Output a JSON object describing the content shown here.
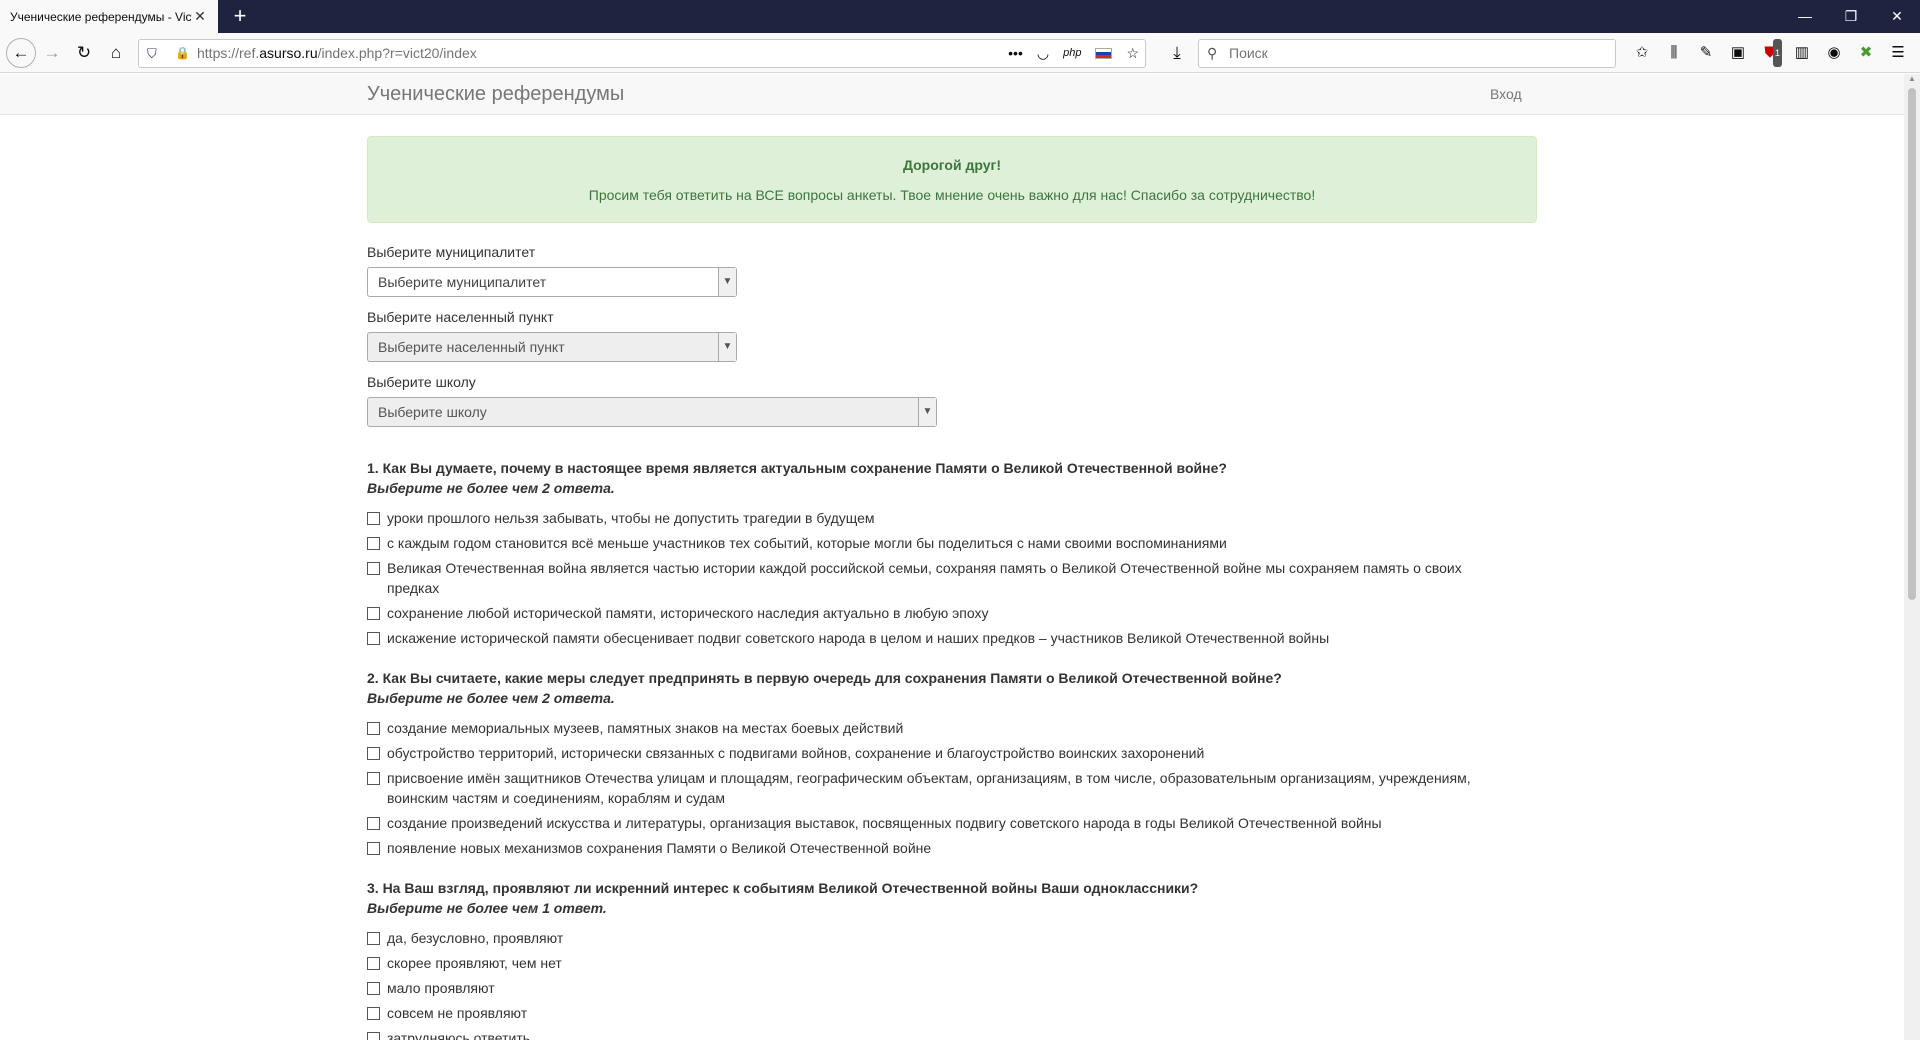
{
  "browser": {
    "tab_title": "Ученические референдумы - Vict",
    "tab_close": "✕",
    "new_tab": "+",
    "url_prefix": "https://ref.",
    "url_domain": "asurso.ru",
    "url_path": "/index.php?r=vict20/index",
    "search_placeholder": "Поиск",
    "php_label": "php",
    "icons": [
      "back-icon",
      "forward-icon",
      "reload-icon",
      "home-icon",
      "shield-icon",
      "lock-icon",
      "more-icon",
      "pocket-icon",
      "star-icon",
      "download-icon",
      "search-icon",
      "bookmarks-icon",
      "library-icon",
      "eyedropper-icon",
      "screenshot-icon",
      "ublock-icon",
      "sidebar-icon",
      "account-icon",
      "extension-icon",
      "menu-icon"
    ],
    "ublock_badge": "1"
  },
  "site": {
    "title": "Ученические референдумы",
    "login": "Вход"
  },
  "alert": {
    "title": "Дорогой друг!",
    "text": "Просим тебя ответить на ВСЕ вопросы анкеты. Твое мнение очень важно для нас! Спасибо за сотрудничество!"
  },
  "filters": {
    "municipality": {
      "label": "Выберите муниципалитет",
      "value": "Выберите муниципалитет"
    },
    "locality": {
      "label": "Выберите населенный пункт",
      "value": "Выберите населенный пункт"
    },
    "school": {
      "label": "Выберите школу",
      "value": "Выберите школу"
    }
  },
  "questions": [
    {
      "title": "1. Как Вы думаете, почему в настоящее время является актуальным сохранение Памяти о Великой Отечественной войне?",
      "hint": "Выберите не более чем 2 ответа.",
      "options": [
        "уроки прошлого нельзя забывать, чтобы не допустить трагедии в будущем",
        "с каждым годом становится всё меньше участников тех событий, которые могли бы поделиться с нами своими воспоминаниями",
        "Великая Отечественная война является частью истории каждой российской семьи, сохраняя память о Великой Отечественной войне мы сохраняем память о своих предках",
        "сохранение любой исторической памяти, исторического наследия актуально в любую эпоху",
        "искажение исторической памяти обесценивает подвиг советского народа в целом и наших предков – участников Великой Отечественной войны"
      ]
    },
    {
      "title": "2. Как Вы считаете, какие меры следует предпринять в первую очередь для сохранения Памяти о Великой Отечественной войне?",
      "hint": "Выберите не более чем 2 ответа.",
      "options": [
        "создание мемориальных музеев, памятных знаков на местах боевых действий",
        "обустройство территорий, исторически связанных с подвигами войнов, сохранение и благоустройство воинских захоронений",
        "присвоение имён защитников Отечества улицам и площадям, географическим объектам, организациям, в том числе, образовательным организациям, учреждениям, воинским частям и соединениям, кораблям и судам",
        "создание произведений искусства и литературы, организация выставок, посвященных подвигу советского народа в годы Великой Отечественной войны",
        "появление новых механизмов сохранения Памяти о Великой Отечественной войне"
      ]
    },
    {
      "title": "3. На Ваш взгляд, проявляют ли искренний интерес к событиям Великой Отечественной войны Ваши одноклассники?",
      "hint": "Выберите не более чем 1 ответ.",
      "options": [
        "да, безусловно, проявляют",
        "скорее проявляют, чем нет",
        "мало проявляют",
        "совсем не проявляют",
        "затрудняюсь ответить"
      ]
    }
  ]
}
